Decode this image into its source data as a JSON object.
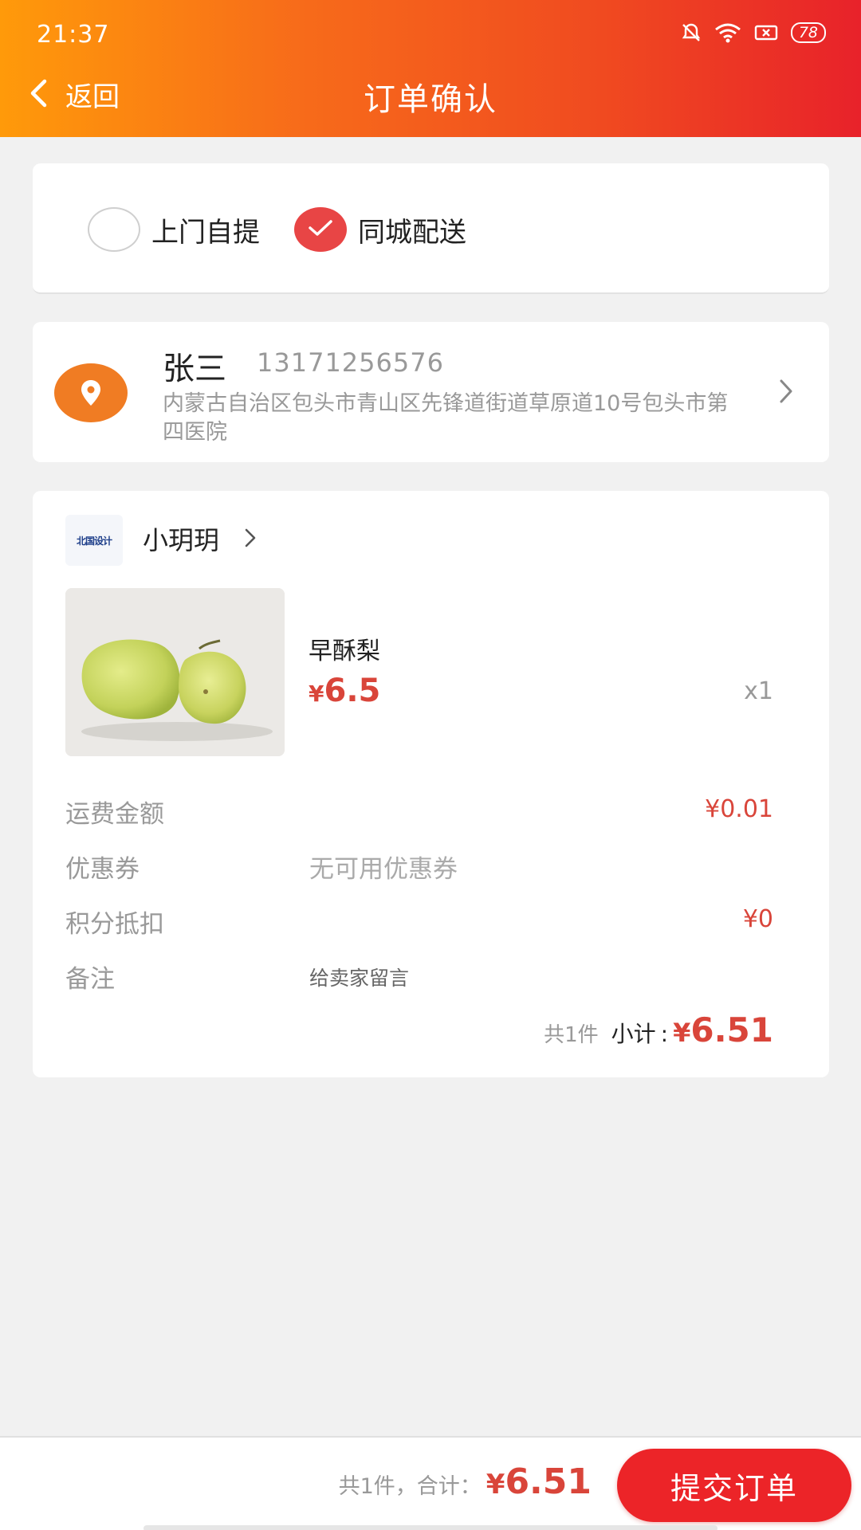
{
  "status_bar": {
    "time": "21:37",
    "battery": "78"
  },
  "header": {
    "back_label": "返回",
    "title": "订单确认"
  },
  "delivery": {
    "options": [
      {
        "label": "上门自提",
        "selected": false
      },
      {
        "label": "同城配送",
        "selected": true
      }
    ]
  },
  "address": {
    "name": "张三",
    "phone": "13171256576",
    "detail": "内蒙古自治区包头市青山区先锋道街道草原道10号包头市第四医院"
  },
  "shop": {
    "name": "小玥玥",
    "logo_text": "北国设计"
  },
  "product": {
    "name": "早酥梨",
    "currency": "¥",
    "price": "6.5",
    "qty": "x1"
  },
  "fees": {
    "shipping_label": "运费金额",
    "shipping_value": "¥0.01",
    "coupon_label": "优惠券",
    "coupon_value": "无可用优惠券",
    "points_label": "积分抵扣",
    "points_value": "¥0",
    "note_label": "备注",
    "note_placeholder": "给卖家留言"
  },
  "subtotal": {
    "count": "共1件",
    "label": "小计",
    "currency": "¥",
    "amount": "6.51"
  },
  "footer": {
    "total_label": "共1件，合计：",
    "currency": "¥",
    "amount": "6.51",
    "submit_label": "提交订单"
  },
  "colors": {
    "accent": "#e84545",
    "price": "#d9453a",
    "pin": "#f07c23",
    "submit": "#ec2428"
  }
}
